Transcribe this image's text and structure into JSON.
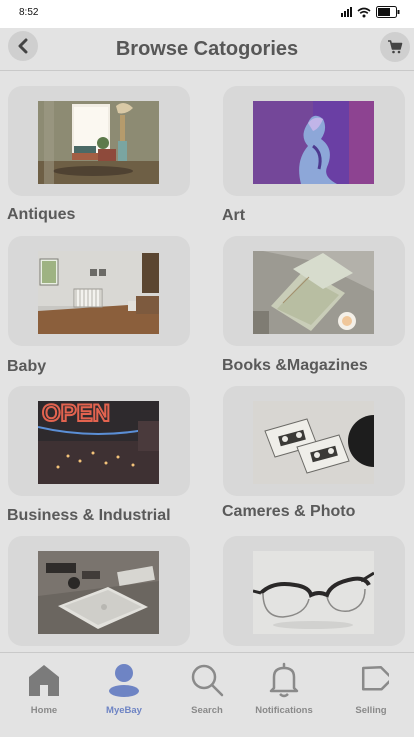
{
  "status_bar": {
    "time": "8:52"
  },
  "header": {
    "title": "Browse Catogories"
  },
  "categories": [
    {
      "label": "Antiques"
    },
    {
      "label": "Art"
    },
    {
      "label": "Baby"
    },
    {
      "label": "Books &Magazines"
    },
    {
      "label": "Business & Industrial"
    },
    {
      "label": "Cameres & Photo"
    },
    {
      "label": ""
    },
    {
      "label": ""
    }
  ],
  "photo_text": {
    "open_sign": "OPEN"
  },
  "tabbar": {
    "items": [
      {
        "label": "Home",
        "icon": "home-icon"
      },
      {
        "label": "MyeBay",
        "icon": "user-icon"
      },
      {
        "label": "Search",
        "icon": "search-icon"
      },
      {
        "label": "Notifications",
        "icon": "bell-icon"
      },
      {
        "label": "Selling",
        "icon": "tag-icon"
      }
    ],
    "active_index": 1
  },
  "colors": {
    "active_tab": "#6e84c4",
    "background": "#e3e3e3",
    "card": "#d8d8d8"
  }
}
